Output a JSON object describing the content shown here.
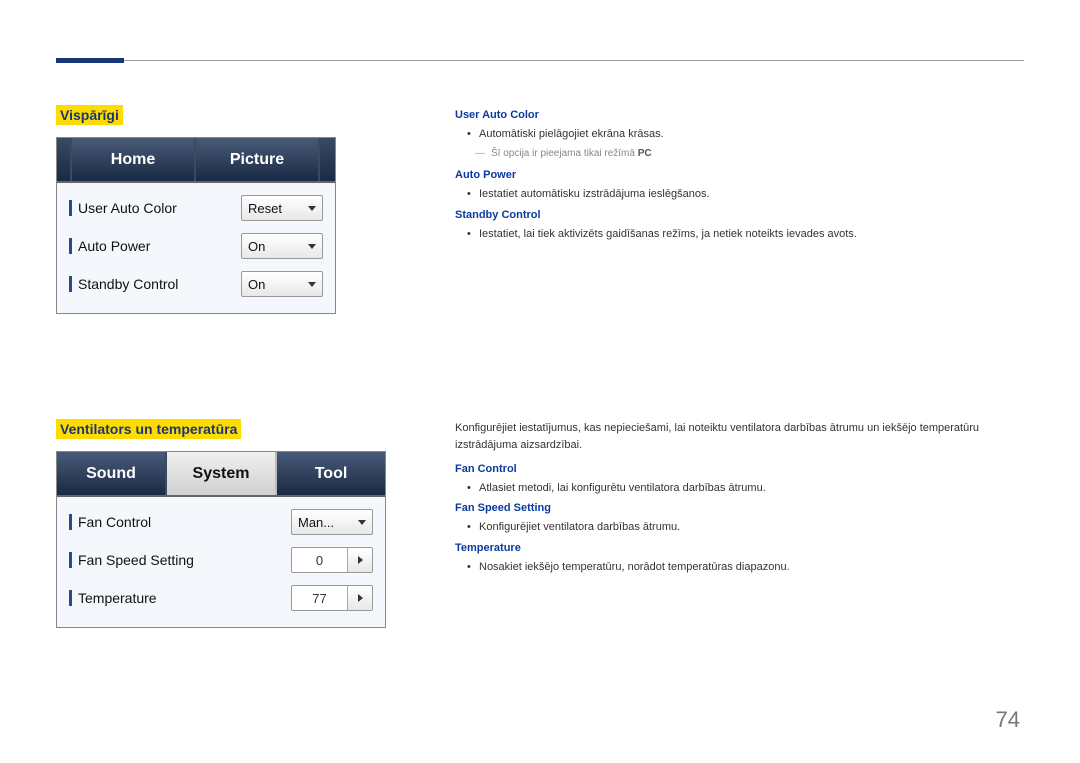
{
  "section1": {
    "title": "Vispārīgi",
    "tabs": {
      "a": "Home",
      "b": "Picture"
    },
    "rows": [
      {
        "label": "User Auto Color",
        "value": "Reset",
        "kind": "dd"
      },
      {
        "label": "Auto Power",
        "value": "On",
        "kind": "dd"
      },
      {
        "label": "Standby Control",
        "value": "On",
        "kind": "dd"
      }
    ]
  },
  "section2": {
    "title": "Ventilators un temperatūra",
    "tabs": {
      "a": "Sound",
      "b": "System",
      "c": "Tool"
    },
    "rows": [
      {
        "label": "Fan Control",
        "value": "Man...",
        "kind": "dd"
      },
      {
        "label": "Fan Speed Setting",
        "value": "0",
        "kind": "pager"
      },
      {
        "label": "Temperature",
        "value": "77",
        "kind": "pager"
      }
    ]
  },
  "desc1": {
    "h1": "User Auto Color",
    "b1": "Automātiski pielāgojiet ekrāna krāsas.",
    "n1": "Šī opcija ir pieejama tikai režīmā ",
    "n1b": "PC",
    "h2": "Auto Power",
    "b2": "Iestatiet automātisku izstrādājuma ieslēgšanos.",
    "h3": "Standby Control",
    "b3": "Iestatiet, lai tiek aktivizēts gaidīšanas režīms, ja netiek noteikts ievades avots."
  },
  "desc2": {
    "intro": "Konfigurējiet iestatījumus, kas nepieciešami, lai noteiktu ventilatora darbības ātrumu un iekšējo temperatūru izstrādājuma aizsardzībai.",
    "h1": "Fan Control",
    "b1": "Atlasiet metodi, lai konfigurētu ventilatora darbības ātrumu.",
    "h2": "Fan Speed Setting",
    "b2": "Konfigurējiet ventilatora darbības ātrumu.",
    "h3": "Temperature",
    "b3": "Nosakiet iekšējo temperatūru, norādot temperatūras diapazonu."
  },
  "page": "74"
}
